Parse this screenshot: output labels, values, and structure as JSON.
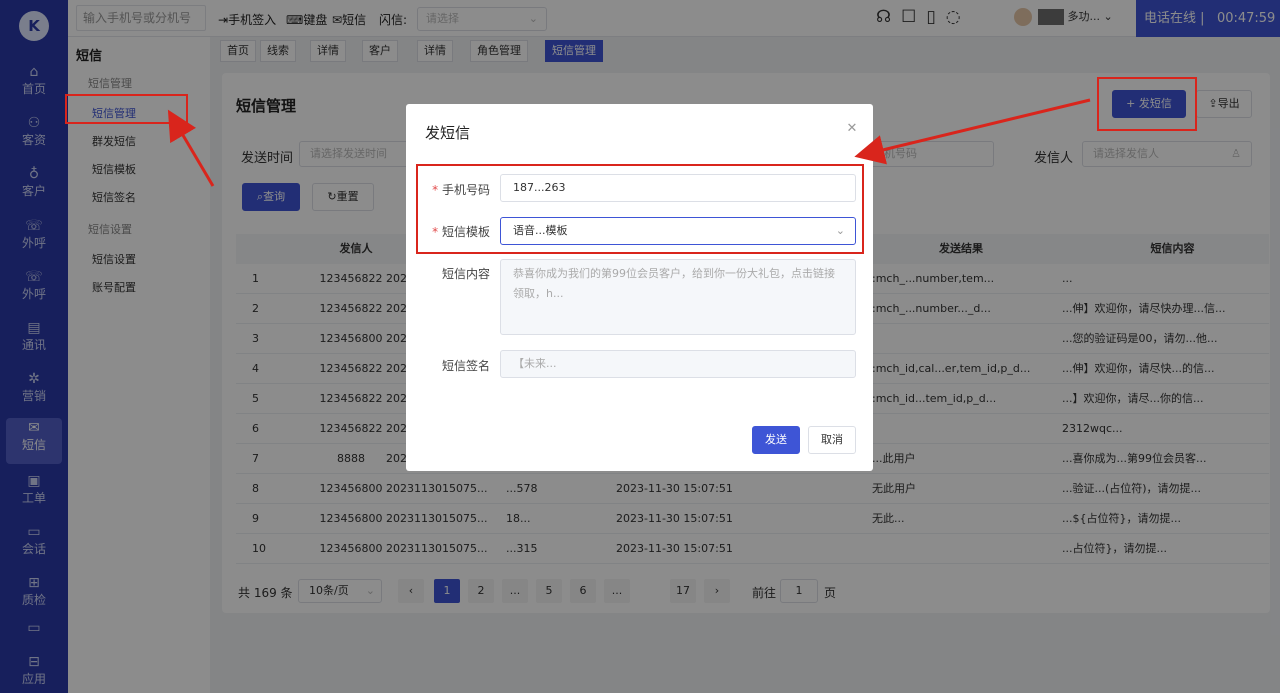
{
  "app": {
    "logo_text": "K"
  },
  "rail": [
    {
      "icon": "⌂",
      "label": "首页"
    },
    {
      "icon": "⚇",
      "label": "客资"
    },
    {
      "icon": "♁",
      "label": "客户"
    },
    {
      "icon": "☏",
      "label": "外呼"
    },
    {
      "icon": "☏",
      "label": "外呼"
    },
    {
      "icon": "▤",
      "label": "通讯"
    },
    {
      "icon": "✲",
      "label": "营销"
    },
    {
      "icon": "✉",
      "label": "短信"
    },
    {
      "icon": "▣",
      "label": "工单"
    },
    {
      "icon": "▭",
      "label": "会话"
    },
    {
      "icon": "⊞",
      "label": "质检"
    },
    {
      "icon": "▭",
      "label": ""
    },
    {
      "icon": "⊟",
      "label": "应用"
    }
  ],
  "topbar": {
    "search_placeholder": "输入手机号或分机号",
    "phone_checkin": "手机签入",
    "keyboard": "键盘",
    "sms": "短信",
    "flash_label": "闪信:",
    "flash_placeholder": "请选择",
    "user_role": "多功...",
    "status": "电话在线",
    "timer": "00:47:59"
  },
  "submenu": {
    "title": "短信",
    "group1": "短信管理",
    "items1": [
      "短信管理",
      "群发短信",
      "短信模板",
      "短信签名"
    ],
    "group2": "短信设置",
    "items2": [
      "短信设置",
      "账号配置"
    ]
  },
  "tabs": [
    "首页",
    "线索",
    "详情",
    "客户",
    "详情",
    "角色管理",
    "短信管理"
  ],
  "page": {
    "title": "短信管理",
    "send_sms": "+ 发短信",
    "export": "导出",
    "send_time_label": "发送时间",
    "send_time_placeholder": "请选择发送时间",
    "phone_placeholder": "手机号码",
    "sender_label": "发信人",
    "sender_placeholder": "请选择发信人",
    "query": "查询",
    "reset": "重置"
  },
  "table": {
    "headers": [
      "发信人",
      "发送结果",
      "短信内容"
    ],
    "rows": [
      {
        "no": "1",
        "sender": "123456822",
        "id": "2023...",
        "phone": "",
        "time": "",
        "result": ":mch_...number,tem...",
        "content": "..."
      },
      {
        "no": "2",
        "sender": "123456822",
        "id": "2023...",
        "phone": "",
        "time": "",
        "result": ":mch_...number..._d...",
        "content": "...伸】欢迎你，请尽快办理...信..."
      },
      {
        "no": "3",
        "sender": "123456800",
        "id": "2023...",
        "phone": "",
        "time": "",
        "result": "",
        "content": "...您的验证码是00，请勿...他..."
      },
      {
        "no": "4",
        "sender": "123456822",
        "id": "2023...",
        "phone": "",
        "time": "",
        "result": ":mch_id,cal...er,tem_id,p_d...",
        "content": "...伸】欢迎你，请尽快...的信..."
      },
      {
        "no": "5",
        "sender": "123456822",
        "id": "2023...",
        "phone": "",
        "time": "",
        "result": ":mch_id...tem_id,p_d...",
        "content": "...】欢迎你，请尽...你的信..."
      },
      {
        "no": "6",
        "sender": "123456822",
        "id": "2023...",
        "phone": "",
        "time": "",
        "result": "",
        "content": "2312wqc..."
      },
      {
        "no": "7",
        "sender": "8888",
        "id": "2023...",
        "phone": "",
        "time": "",
        "result": "...此用户",
        "content": "...喜你成为...第99位会员客..."
      },
      {
        "no": "8",
        "sender": "123456800",
        "id": "2023113015075...",
        "phone": "...578",
        "time": "2023-11-30 15:07:51",
        "result": "无此用户",
        "content": "...验证...(占位符)，请勿提..."
      },
      {
        "no": "9",
        "sender": "123456800",
        "id": "2023113015075...",
        "phone": "18...",
        "time": "2023-11-30 15:07:51",
        "result": "无此...",
        "content": "...${占位符}，请勿提..."
      },
      {
        "no": "10",
        "sender": "123456800",
        "id": "2023113015075...",
        "phone": "...315",
        "time": "2023-11-30 15:07:51",
        "result": "",
        "content": "...占位符}，请勿提..."
      }
    ]
  },
  "pager": {
    "total": "共 169 条",
    "size": "10条/页",
    "pages": [
      "1",
      "2",
      "...",
      "5",
      "6",
      "...",
      "17"
    ],
    "goto": "前往",
    "goto_value": "1",
    "page_unit": "页"
  },
  "modal": {
    "title": "发短信",
    "phone_label": "手机号码",
    "phone_value": "187...263",
    "template_label": "短信模板",
    "template_value": "语音...模板",
    "content_label": "短信内容",
    "content_value": "恭喜你成为我们的第99位会员客户，给到你一份大礼包，点击链接领取，h...",
    "sign_label": "短信签名",
    "sign_value": "【未来...",
    "send": "发送",
    "cancel": "取消"
  }
}
